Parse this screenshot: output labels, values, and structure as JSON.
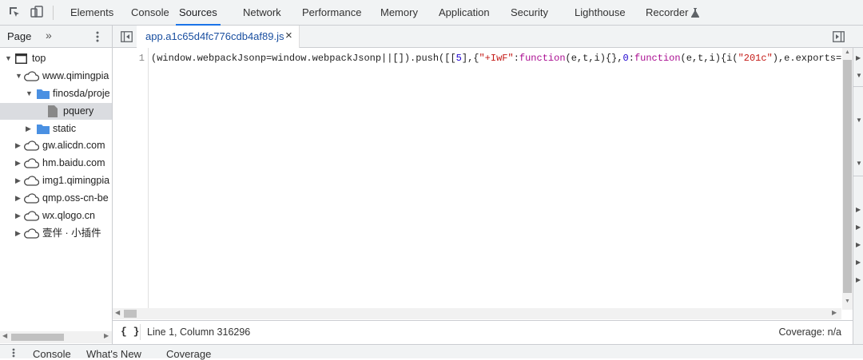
{
  "toolbar": {
    "tabs": [
      "Elements",
      "Console",
      "Sources",
      "Network",
      "Performance",
      "Memory",
      "Application",
      "Security",
      "Lighthouse",
      "Recorder"
    ],
    "active_tab": "Sources"
  },
  "navigator": {
    "tab_label": "Page",
    "more_label": "»",
    "tree": [
      {
        "label": "top",
        "type": "frame",
        "level": 0,
        "expanded": true
      },
      {
        "label": "www.qimingpia",
        "type": "cloud",
        "level": 1,
        "expanded": true
      },
      {
        "label": "finosda/proje",
        "type": "folder",
        "level": 2,
        "expanded": true
      },
      {
        "label": "pquery",
        "type": "file",
        "level": 3,
        "selected": true
      },
      {
        "label": "static",
        "type": "folder",
        "level": 2,
        "expanded": false
      },
      {
        "label": "gw.alicdn.com",
        "type": "cloud",
        "level": 1,
        "expanded": false
      },
      {
        "label": "hm.baidu.com",
        "type": "cloud",
        "level": 1,
        "expanded": false
      },
      {
        "label": "img1.qimingpia",
        "type": "cloud",
        "level": 1,
        "expanded": false
      },
      {
        "label": "qmp.oss-cn-be",
        "type": "cloud",
        "level": 1,
        "expanded": false
      },
      {
        "label": "wx.qlogo.cn",
        "type": "cloud",
        "level": 1,
        "expanded": false
      },
      {
        "label": "壹伴 · 小插件",
        "type": "cloud",
        "level": 1,
        "expanded": false
      }
    ]
  },
  "editor": {
    "file_tab": "app.a1c65d4fc776cdb4af89.js",
    "close_glyph": "×",
    "line_number": "1",
    "code_parts": {
      "p1": "(window.webpackJsonp=window.webpackJsonp||[]).push([[",
      "p2": "5",
      "p3": "],{",
      "p4": "\"+IwF\"",
      "p5": ":",
      "p6": "function",
      "p7": "(e,t,i){},",
      "p8": "0",
      "p9": ":",
      "p10": "function",
      "p11": "(e,t,i){i(",
      "p12": "\"201c\"",
      "p13": "),e.exports="
    }
  },
  "status": {
    "format_glyph": "{ }",
    "cursor": "Line 1, Column 316296",
    "coverage": "Coverage: n/a"
  },
  "drawer": {
    "tabs": [
      "Console",
      "What's New",
      "Coverage"
    ]
  },
  "colors": {
    "accent": "#1a73e8",
    "keyword": "#aa0d91",
    "string": "#c41a16",
    "number": "#1c00cf"
  }
}
